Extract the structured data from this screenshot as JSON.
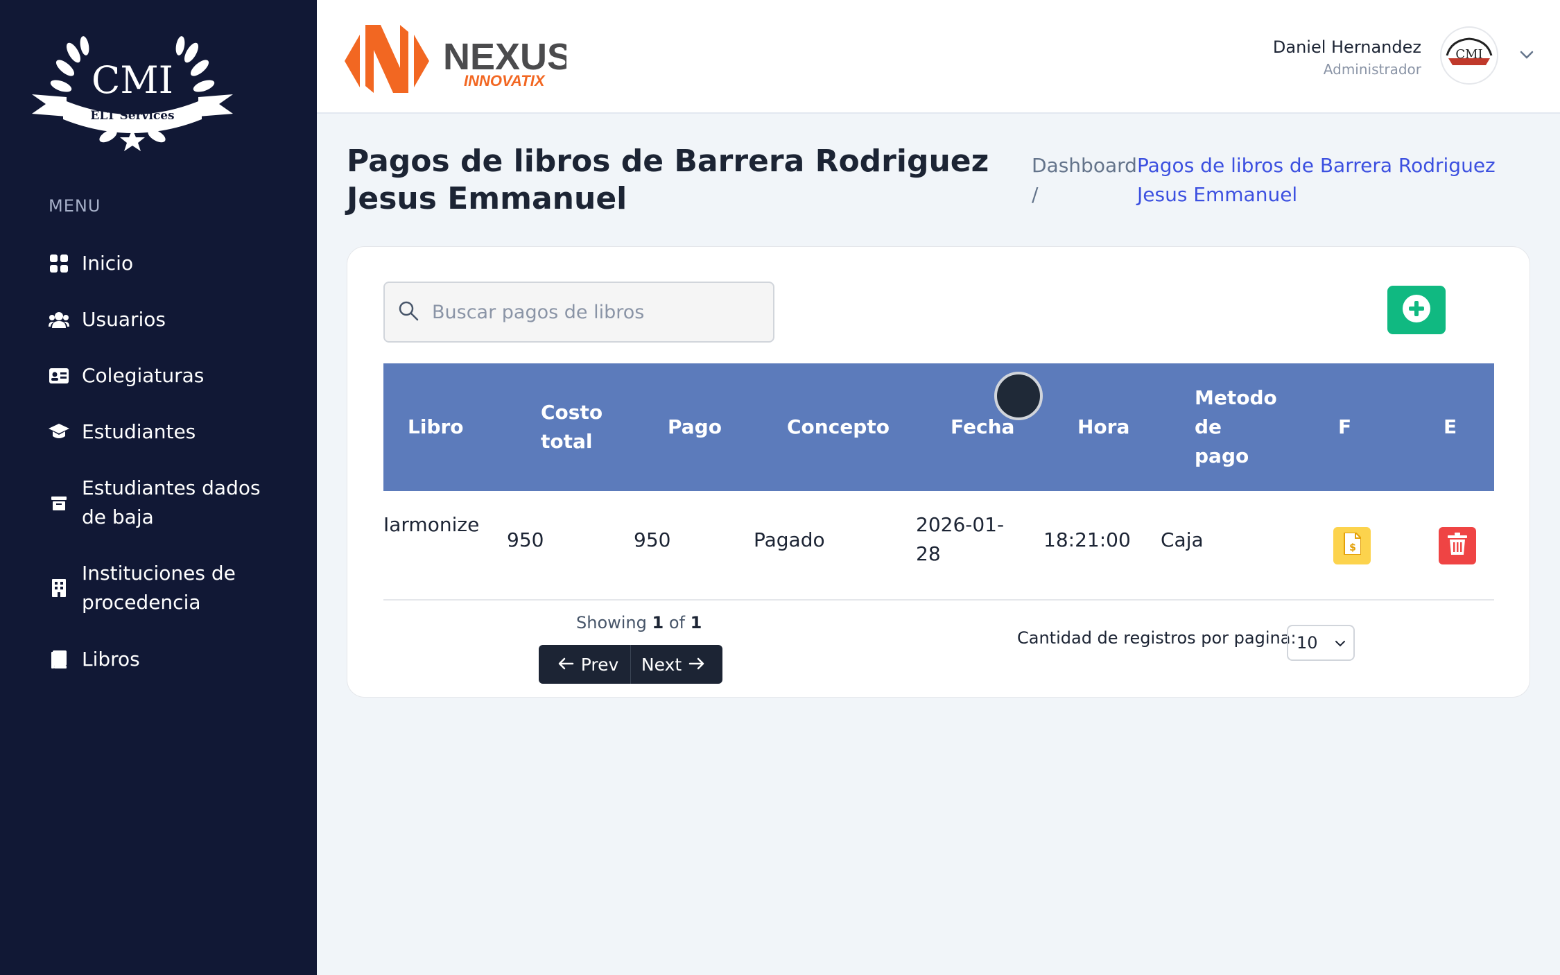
{
  "sidebar": {
    "logo_text": "CMI",
    "logo_subtitle": "ELT Services",
    "menu_heading": "MENU",
    "items": [
      {
        "label": "Inicio",
        "icon": "grid-icon"
      },
      {
        "label": "Usuarios",
        "icon": "users-icon"
      },
      {
        "label": "Colegiaturas",
        "icon": "id-card-icon"
      },
      {
        "label": "Estudiantes",
        "icon": "graduation-cap-icon"
      },
      {
        "label": "Estudiantes dados de baja",
        "icon": "archive-icon"
      },
      {
        "label": "Instituciones de procedencia",
        "icon": "building-icon"
      },
      {
        "label": "Libros",
        "icon": "book-icon"
      }
    ]
  },
  "header": {
    "brand_main": "NEXUS",
    "brand_sub": "INNOVATIX",
    "user_name": "Daniel Hernandez",
    "user_role": "Administrador",
    "avatar_text": "CMI"
  },
  "page": {
    "title": "Pagos de libros de Barrera Rodriguez Jesus Emmanuel",
    "breadcrumb_home": "Dashboard /",
    "breadcrumb_current": "Pagos de libros de Barrera Rodriguez Jesus Emmanuel"
  },
  "search": {
    "placeholder": "Buscar pagos de libros"
  },
  "table": {
    "headers": [
      "Libro",
      "Costo total",
      "Pago",
      "Concepto",
      "Fecha",
      "Hora",
      "Metodo de pago",
      "F",
      "E"
    ],
    "rows": [
      {
        "libro": "Iarmonize",
        "costo_total": "950",
        "pago": "950",
        "concepto": "Pagado",
        "fecha": "2026-01-28",
        "hora": "18:21:00",
        "metodo": "Caja"
      }
    ]
  },
  "pagination": {
    "showing_prefix": "Showing",
    "current": "1",
    "of_label": "of",
    "total": "1",
    "prev_label": "Prev",
    "next_label": "Next",
    "per_page_label": "Cantidad de registros por pagina:",
    "per_page_value": "10"
  },
  "colors": {
    "sidebar": "#111835",
    "table_header": "#5c7bbb",
    "add": "#10b981",
    "pdf": "#fcd34d",
    "delete": "#ef4444",
    "link": "#3c50e0"
  }
}
